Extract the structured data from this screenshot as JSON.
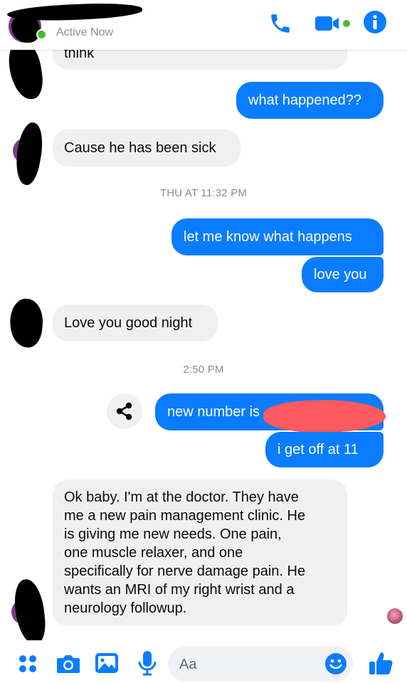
{
  "header": {
    "status_text": "Active Now",
    "icons": [
      "phone-icon",
      "video-camera-icon",
      "info-icon"
    ],
    "accent_color": "#0a7cff",
    "online_color": "#44bd32"
  },
  "messages": {
    "partial_in": "think",
    "out_1": "what happened??",
    "in_1": "Cause he has been sick",
    "out_2": "let me know what happens",
    "out_3": "love you",
    "in_2": "Love you good night",
    "out_4": "new number is",
    "out_5": "i get off at 11",
    "in_3_lines": [
      "Ok baby. I'm at the doctor.  They have",
      "me a new pain management clinic. He",
      "is giving me new needs.  One pain,",
      "one muscle relaxer,  and one",
      "specifically for nerve damage pain. He",
      "wants an MRI of my right wrist and a",
      "neurology followup."
    ]
  },
  "timestamps": {
    "t1": "THU AT 11:32 PM",
    "t2": "2:50 PM"
  },
  "composer": {
    "placeholder": "Aa",
    "icons": [
      "apps-icon",
      "camera-icon",
      "photo-icon",
      "microphone-icon",
      "emoji-icon",
      "thumbs-up-icon"
    ]
  },
  "colors": {
    "outgoing_bubble": "#0a7cff",
    "incoming_bubble": "#f0f0f0",
    "timestamp_text": "#8a8d91"
  }
}
